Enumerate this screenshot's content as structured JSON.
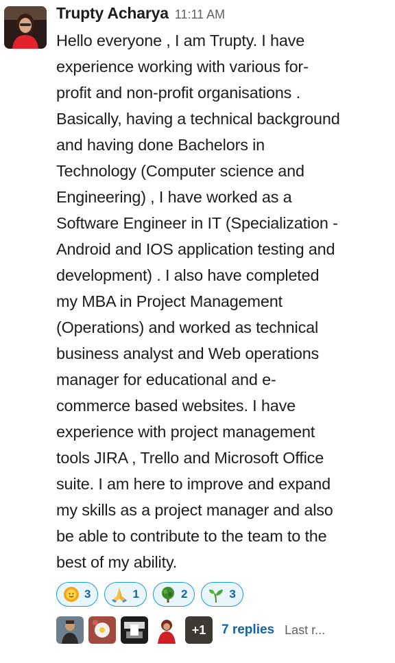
{
  "message": {
    "author": "Trupty Acharya",
    "timestamp": "11:11 AM",
    "text": "Hello everyone , I am Trupty. I have\nexperience working with various for-\nprofit and non-profit organisations .\nBasically, having a technical background\nand having done Bachelors in\nTechnology (Computer science and\nEngineering) , I have worked as a\nSoftware Engineer in IT (Specialization -\nAndroid and IOS application testing and\ndevelopment)  . I also have completed\nmy MBA in Project Management\n(Operations) and worked as technical\nbusiness analyst and Web operations\nmanager for educational and e-\ncommerce based websites. I have\nexperience with project management\ntools JIRA , Trello and Microsoft Office\nsuite. I am here to improve and expand\nmy skills as a project manager and also\nbe able to contribute to the team to the\nbest of my ability."
  },
  "reactions": [
    {
      "icon": "sun-emoji-icon",
      "count": "3"
    },
    {
      "icon": "folded-hands-emoji-icon",
      "count": "1"
    },
    {
      "icon": "tree-emoji-icon",
      "count": "2"
    },
    {
      "icon": "seedling-emoji-icon",
      "count": "3"
    }
  ],
  "thread": {
    "extra_participants": "+1",
    "replies_label": "7 replies",
    "last_reply_label": "Last r..."
  },
  "colors": {
    "link": "#1264a3",
    "reaction_border": "#1d9bd1",
    "reaction_bg": "#e8f5fa"
  }
}
